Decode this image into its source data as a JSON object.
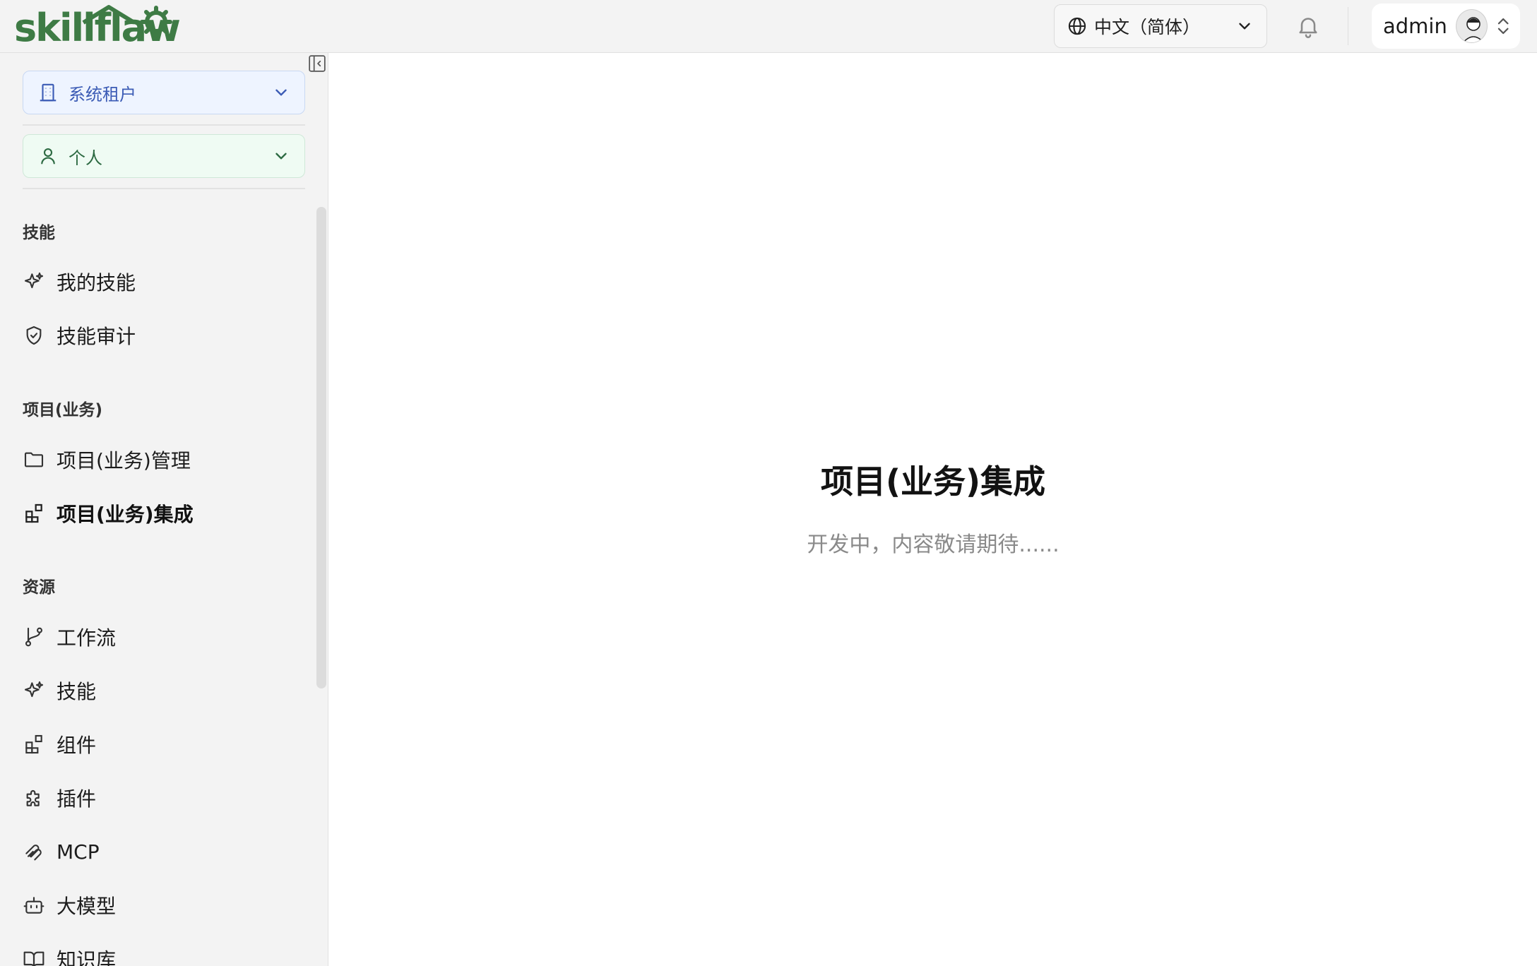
{
  "brand": {
    "logo_text": "skillflaw",
    "accent_color": "#3e7b45"
  },
  "header": {
    "language": {
      "value": "中文（简体）",
      "icon": "globe-icon"
    },
    "notifications_icon": "bell-icon",
    "user": {
      "name": "admin",
      "avatar": "avatar-icon"
    }
  },
  "sidebar": {
    "tenant_select": {
      "value": "系统租户",
      "icon": "building-icon",
      "color": "#3b5bb5"
    },
    "space_select": {
      "value": "个人",
      "icon": "user-icon",
      "color": "#2d6a42"
    },
    "sections": [
      {
        "title": "技能",
        "items": [
          {
            "label": "我的技能",
            "icon": "sparkle-icon"
          },
          {
            "label": "技能审计",
            "icon": "shield-check-icon"
          }
        ]
      },
      {
        "title": "项目(业务)",
        "items": [
          {
            "label": "项目(业务)管理",
            "icon": "folder-icon"
          },
          {
            "label": "项目(业务)集成",
            "icon": "blocks-icon",
            "active": true
          }
        ]
      },
      {
        "title": "资源",
        "items": [
          {
            "label": "工作流",
            "icon": "branch-icon"
          },
          {
            "label": "技能",
            "icon": "sparkle-icon"
          },
          {
            "label": "组件",
            "icon": "blocks-icon"
          },
          {
            "label": "插件",
            "icon": "puzzle-icon"
          },
          {
            "label": "MCP",
            "icon": "mcp-icon"
          },
          {
            "label": "大模型",
            "icon": "bot-icon"
          },
          {
            "label": "知识库",
            "icon": "book-icon"
          }
        ]
      }
    ]
  },
  "main": {
    "title": "项目(业务)集成",
    "subtitle": "开发中，内容敬请期待......"
  }
}
